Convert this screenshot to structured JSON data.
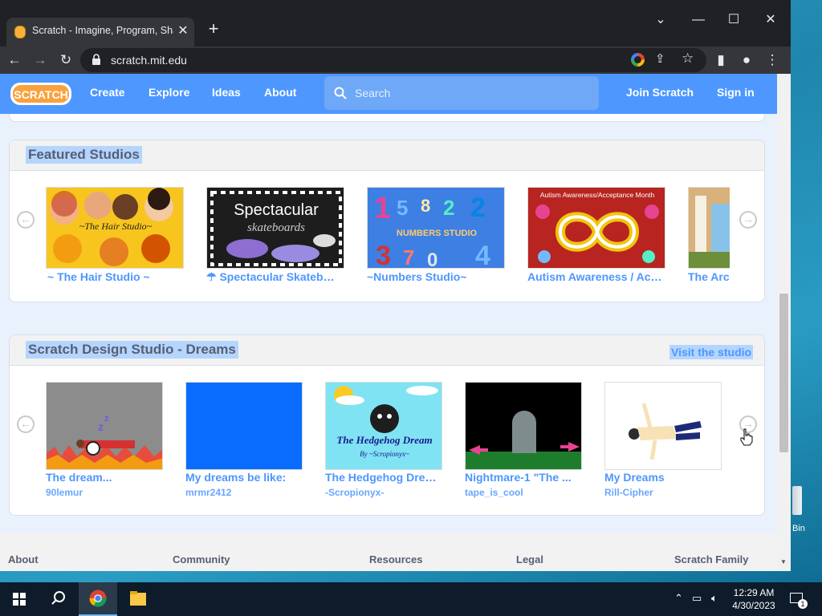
{
  "browser": {
    "tab_title": "Scratch - Imagine, Program, Share",
    "url": "scratch.mit.edu"
  },
  "nav": {
    "logo_text": "SCRATCH",
    "links": [
      "Create",
      "Explore",
      "Ideas",
      "About"
    ],
    "search_placeholder": "Search",
    "join": "Join Scratch",
    "signin": "Sign in"
  },
  "featured": {
    "title": "Featured Studios",
    "items": [
      {
        "title": "~ The Hair Studio ~",
        "image_caption": "~The Hair Studio~"
      },
      {
        "title": "☂ Spectacular Skateboards",
        "image_caption": "Spectacular",
        "image_caption_2": "skateboards"
      },
      {
        "title": "~Numbers Studio~",
        "image_caption": "NUMBERS STUDIO"
      },
      {
        "title": "Autism Awareness / Acceptance Month",
        "image_caption": "Autism Awareness/Acceptance Month"
      },
      {
        "title": "The Arc"
      }
    ]
  },
  "design": {
    "title": "Scratch Design Studio - Dreams",
    "visit": "Visit the studio",
    "items": [
      {
        "title": "The dream...",
        "author": "90lemur"
      },
      {
        "title": "My dreams be like:",
        "author": "mrmr2412"
      },
      {
        "title": "The Hedgehog Dream",
        "author": "-Scropionyx-",
        "image_caption": "The Hedgehog Dream",
        "image_caption_2": "By ~Scropionyx~"
      },
      {
        "title": "Nightmare-1 \"The ...",
        "author": "tape_is_cool"
      },
      {
        "title": "My Dreams",
        "author": "Rill-Cipher"
      }
    ]
  },
  "footer": [
    "About",
    "Community",
    "Resources",
    "Legal",
    "Scratch Family"
  ],
  "desktop": {
    "recycle_label": "Bin"
  },
  "taskbar": {
    "time": "12:29 AM",
    "date": "4/30/2023",
    "notifications": "1"
  },
  "colors": {
    "scratch_blue": "#4d97ff",
    "text_gray": "#575e75",
    "orange": "#f9a23c"
  }
}
